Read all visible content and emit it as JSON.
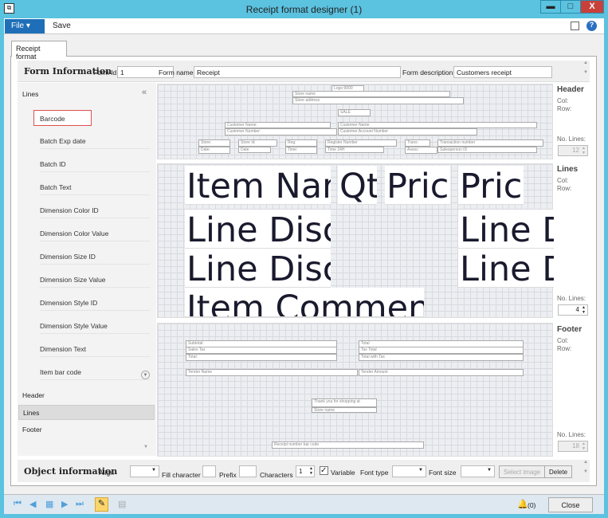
{
  "window": {
    "title": "Receipt format designer (1)",
    "minimize": "▬",
    "maximize": "□",
    "close": "X"
  },
  "menu": {
    "file": "File ▾",
    "save": "Save"
  },
  "tab": "Receipt format",
  "form_info": {
    "heading": "Form Information",
    "form_id_label": "Form Id",
    "form_id": "1",
    "form_name_label": "Form name",
    "form_name": "Receipt",
    "form_desc_label": "Form description",
    "form_desc": "Customers receipt"
  },
  "left": {
    "title": "Lines",
    "collapse": "«",
    "items": [
      "Barcode",
      "Batch Exp date",
      "Batch ID",
      "Batch Text",
      "Dimension Color ID",
      "Dimension Color Value",
      "Dimension Size ID",
      "Dimension Size Value",
      "Dimension Style ID",
      "Dimension Style Value",
      "Dimension Text",
      "Item bar code"
    ],
    "selected_item": "Barcode",
    "sections": [
      "Header",
      "Lines",
      "Footer"
    ],
    "selected_section": "Lines"
  },
  "header_fields": [
    "Logo:9000",
    "Store name",
    "Store address",
    "SALE",
    "Customer Name:",
    "Customer Number:",
    "Customer Name",
    "Customer Account Number",
    "Store:",
    "Date:",
    "Store Id",
    "Date",
    "Reg:",
    "Time:",
    "Register Number",
    "Time 24H",
    "Trans:",
    "Assoc:",
    "Transaction number",
    "Salesperson ID"
  ],
  "line_fields": [
    "Item Name",
    "Qty",
    "Price",
    "Price",
    "Line Discount",
    "Line D",
    "Line Discount",
    "Line D",
    "Item Comment"
  ],
  "footer_fields": [
    "Subtotal:",
    "Sales Tax",
    "Total:",
    "Total",
    "Tax Total",
    "Total with Tax",
    "Tender Name",
    "Tender Amount",
    "Thank you for shopping at",
    "Store name",
    "Receipt number bar code"
  ],
  "side": {
    "header": {
      "title": "Header",
      "col": "Col:",
      "row": "Row:",
      "lines_label": "No. Lines:",
      "lines": "12"
    },
    "lines": {
      "title": "Lines",
      "col": "Col:",
      "row": "Row:",
      "lines_label": "No. Lines:",
      "lines": "4"
    },
    "footer": {
      "title": "Footer",
      "col": "Col:",
      "row": "Row:",
      "lines_label": "No. Lines:",
      "lines": "18"
    }
  },
  "object_info": {
    "heading": "Object information",
    "align": "Align",
    "fill": "Fill character",
    "prefix": "Prefix",
    "characters": "Characters",
    "characters_value": "1",
    "variable": "Variable",
    "variable_checked": true,
    "font_type": "Font type",
    "font_size": "Font size",
    "select_image": "Select image",
    "delete": "Delete"
  },
  "status": {
    "alerts": "(0)",
    "close": "Close"
  },
  "colors": {
    "titlebar": "#5bc2e0",
    "file_button": "#1f6fb8",
    "selection_border": "#e05050"
  }
}
